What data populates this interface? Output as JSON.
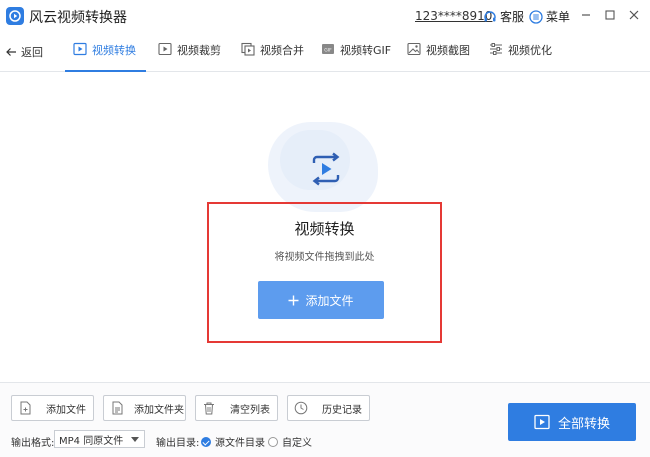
{
  "app": {
    "title": "风云视频转换器",
    "account": "123****8910",
    "service_label": "客服",
    "menu_label": "菜单",
    "accent": "#2f7de1"
  },
  "nav": {
    "back_label": "返回",
    "tabs": [
      {
        "label": "视频转换",
        "icon": "video-convert-icon",
        "active": true
      },
      {
        "label": "视频裁剪",
        "icon": "video-crop-icon",
        "active": false
      },
      {
        "label": "视频合并",
        "icon": "video-merge-icon",
        "active": false
      },
      {
        "label": "视频转GIF",
        "icon": "gif-icon",
        "active": false
      },
      {
        "label": "视频截图",
        "icon": "screenshot-icon",
        "active": false
      },
      {
        "label": "视频优化",
        "icon": "sliders-icon",
        "active": false
      }
    ]
  },
  "main": {
    "title": "视频转换",
    "subtitle": "将视频文件拖拽到此处",
    "add_button": "添加文件",
    "highlight_color": "#e53935"
  },
  "toolbar": {
    "add_file": "添加文件",
    "add_folder": "添加文件夹",
    "clear_list": "清空列表",
    "history": "历史记录"
  },
  "output": {
    "format_label": "输出格式:",
    "format_value": "MP4 同原文件",
    "dir_label": "输出目录:",
    "dir_source": "源文件目录",
    "dir_custom": "自定义",
    "selected": "source"
  },
  "convert_all": "全部转换"
}
